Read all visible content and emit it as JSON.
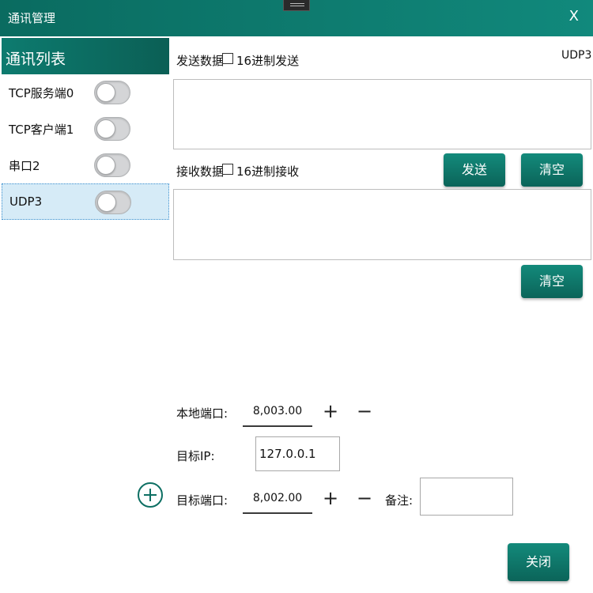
{
  "window": {
    "title": "通讯管理",
    "close_symbol": "X"
  },
  "sidebar": {
    "header": "通讯列表",
    "items": [
      {
        "label": "TCP服务端0",
        "enabled": false
      },
      {
        "label": "TCP客户端1",
        "enabled": false
      },
      {
        "label": "串口2",
        "enabled": false
      },
      {
        "label": "UDP3",
        "enabled": false,
        "selected": true
      }
    ]
  },
  "send": {
    "label": "发送数据",
    "hex_label": "16进制发送",
    "hex_checked": false,
    "channel_name": "UDP3",
    "text": ""
  },
  "receive": {
    "label": "接收数据",
    "hex_label": "16进制接收",
    "hex_checked": false,
    "text": ""
  },
  "buttons": {
    "send": "发送",
    "clear_send": "清空",
    "clear_receive": "清空",
    "close": "关闭"
  },
  "config": {
    "local_port_label": "本地端口:",
    "local_port_value": "8,003.00",
    "target_ip_label": "目标IP:",
    "target_ip_value": "127.0.0.1",
    "target_port_label": "目标端口:",
    "target_port_value": "8,002.00",
    "note_label": "备注:",
    "note_value": "",
    "plus": "+",
    "minus": "−"
  },
  "colors": {
    "accent": "#0d7b6f",
    "selected_bg": "#d6ebf7"
  }
}
